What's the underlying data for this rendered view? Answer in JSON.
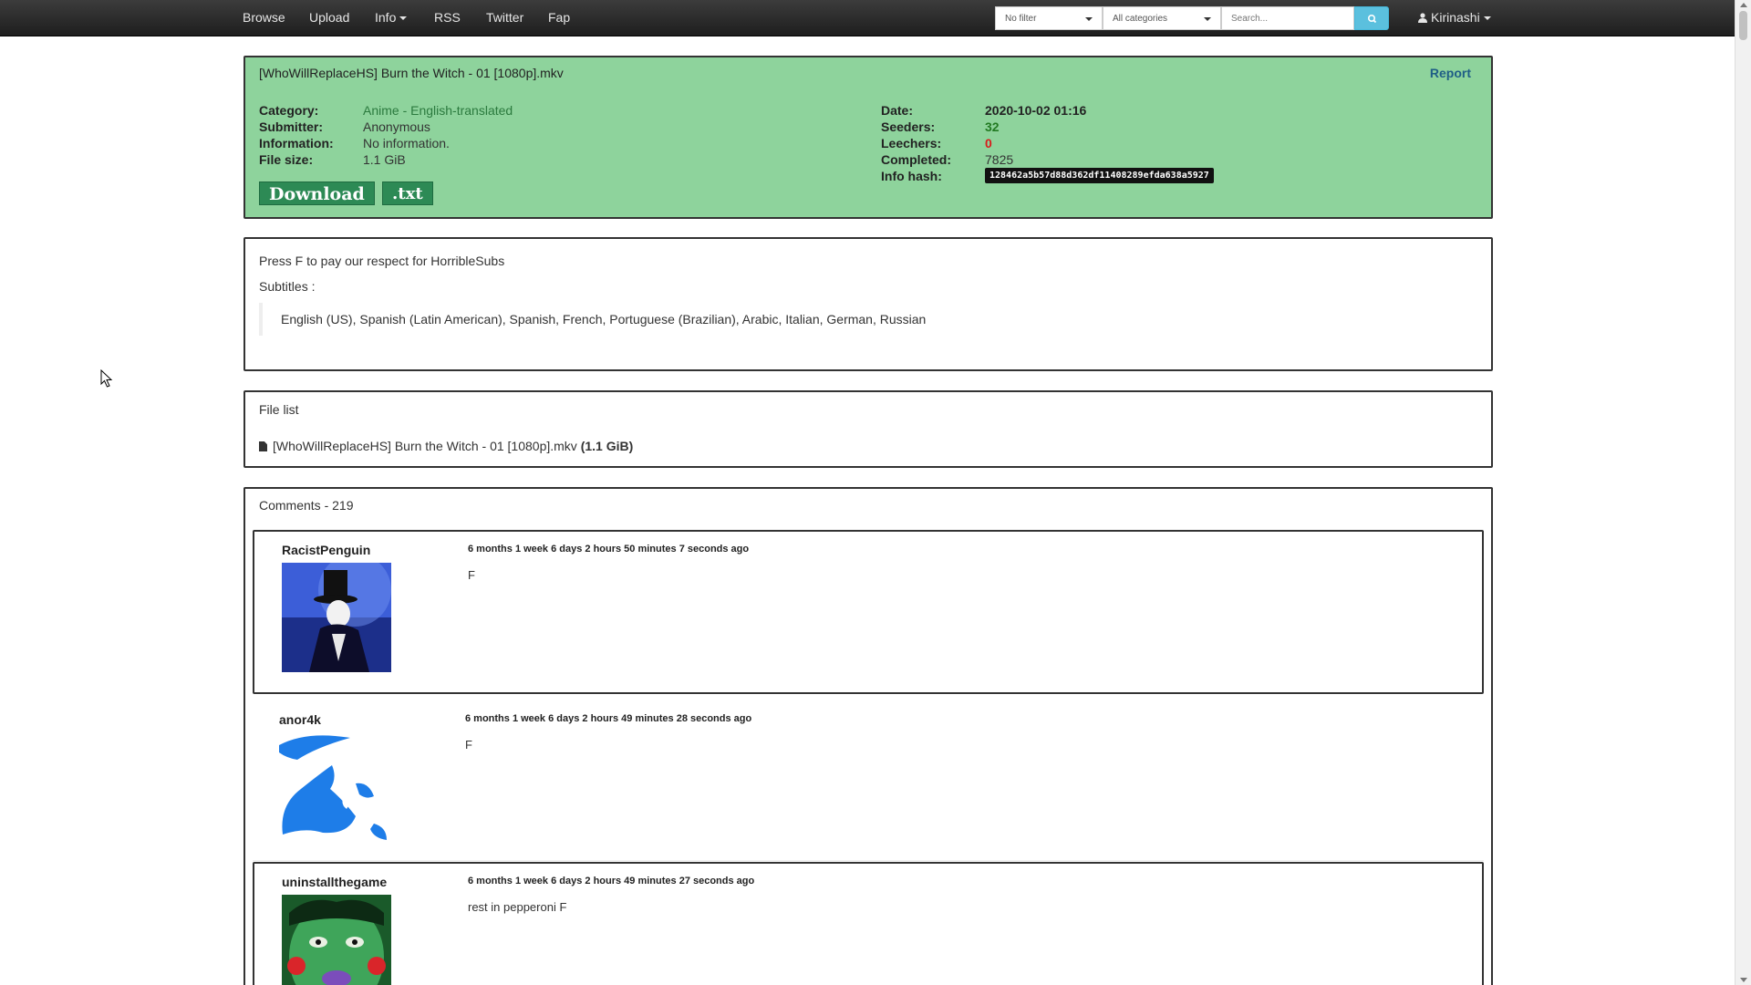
{
  "nav": {
    "browse": "Browse",
    "upload": "Upload",
    "info": "Info",
    "rss": "RSS",
    "twitter": "Twitter",
    "fap": "Fap",
    "filter_value": "No filter",
    "category_value": "All categories",
    "search_placeholder": "Search...",
    "user": "Kirinashi"
  },
  "torrent": {
    "title": "[WhoWillReplaceHS] Burn the Witch - 01 [1080p].mkv",
    "report": "Report",
    "category_label": "Category:",
    "category": "Anime - English-translated",
    "submitter_label": "Submitter:",
    "submitter": "Anonymous",
    "information_label": "Information:",
    "information": "No information.",
    "filesize_label": "File size:",
    "filesize": "1.1 GiB",
    "date_label": "Date:",
    "date": "2020-10-02 01:16",
    "seeders_label": "Seeders:",
    "seeders": "32",
    "leechers_label": "Leechers:",
    "leechers": "0",
    "completed_label": "Completed:",
    "completed": "7825",
    "hash_label": "Info hash:",
    "hash": "128462a5b57d88d362df11408289efda638a5927",
    "download": "Download",
    "txt": ".txt",
    "colors": {
      "panel": "#8ed39c",
      "button": "#2d8a55",
      "leech": "#d81b1b",
      "seed": "#227a22"
    }
  },
  "description": {
    "line1": "Press F to pay our respect for HorribleSubs",
    "line2": "Subtitles :",
    "subtitles": "English (US), Spanish (Latin American), Spanish, French, Portuguese (Brazilian), Arabic, Italian, German, Russian"
  },
  "files": {
    "heading": "File list",
    "items": [
      {
        "name": "[WhoWillReplaceHS] Burn the Witch - 01 [1080p].mkv",
        "size": "(1.1 GiB)"
      }
    ]
  },
  "comments": {
    "heading": "Comments - 219",
    "items": [
      {
        "user": "RacistPenguin",
        "time": "6 months 1 week 6 days 2 hours 50 minutes 7 seconds ago",
        "text": "F"
      },
      {
        "user": "anor4k",
        "time": "6 months 1 week 6 days 2 hours 49 minutes 28 seconds ago",
        "text": "F"
      },
      {
        "user": "uninstallthegame",
        "time": "6 months 1 week 6 days 2 hours 49 minutes 27 seconds ago",
        "text": "rest in pepperoni F"
      }
    ]
  }
}
